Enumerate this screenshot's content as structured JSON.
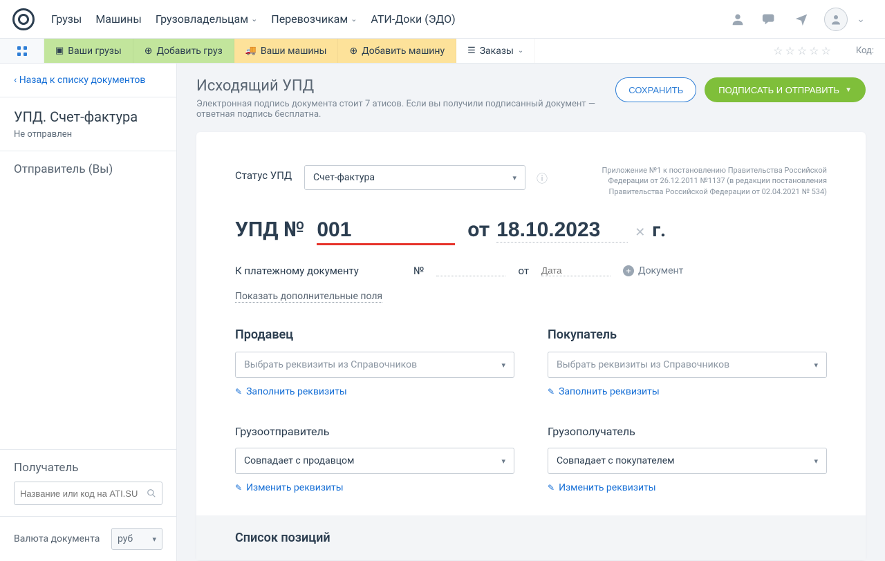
{
  "topnav": {
    "items": [
      "Грузы",
      "Машины",
      "Грузовладельцам",
      "Перевозчикам",
      "АТИ-Доки (ЭДО)"
    ],
    "hasChevron": [
      false,
      false,
      true,
      true,
      false
    ]
  },
  "secbar": {
    "items": [
      {
        "label": "Ваши грузы"
      },
      {
        "label": "Добавить груз"
      },
      {
        "label": "Ваши машины"
      },
      {
        "label": "Добавить машину"
      },
      {
        "label": "Заказы"
      }
    ],
    "code_label": "Код:"
  },
  "sidebar": {
    "back": "Назад к списку документов",
    "doc_title": "УПД. Счет-фактура",
    "doc_status": "Не отправлен",
    "sender_heading": "Отправитель (Вы)",
    "recipient_heading": "Получатель",
    "search_placeholder": "Название или код на ATI.SU",
    "currency_label": "Валюта документа",
    "currency_value": "руб"
  },
  "header": {
    "title": "Исходящий УПД",
    "subtitle": "Электронная подпись документа стоит 7 атисов. Если вы получили подписанный документ — ответная подпись бесплатна.",
    "save_btn": "СОХРАНИТЬ",
    "send_btn": "ПОДПИСАТЬ И ОТПРАВИТЬ"
  },
  "form": {
    "status_label": "Статус УПД",
    "status_value": "Счет-фактура",
    "regulation": "Приложение №1 к постановлению Правительства Российской Федерации от 26.12.2011 №1137 (в редакции постановления Правительства Российской Федерации от 02.04.2021 № 534)",
    "upd_label": "УПД №",
    "upd_number": "001",
    "upd_date_label": "от",
    "upd_date": "18.10.2023",
    "upd_suffix": "г.",
    "paydoc_label": "К платежному документу",
    "paydoc_no_label": "№",
    "paydoc_date_label": "от",
    "paydoc_date_placeholder": "Дата",
    "paydoc_add": "Документ",
    "extra_link": "Показать дополнительные поля",
    "seller_title": "Продавец",
    "buyer_title": "Покупатель",
    "select_placeholder": "Выбрать реквизиты из Справочников",
    "fill_link": "Заполнить реквизиты",
    "shipper_title": "Грузоотправитель",
    "consignee_title": "Грузополучатель",
    "shipper_value": "Совпадает с продавцом",
    "consignee_value": "Совпадает с покупателем",
    "change_link": "Изменить реквизиты",
    "positions_title": "Список позиций"
  }
}
